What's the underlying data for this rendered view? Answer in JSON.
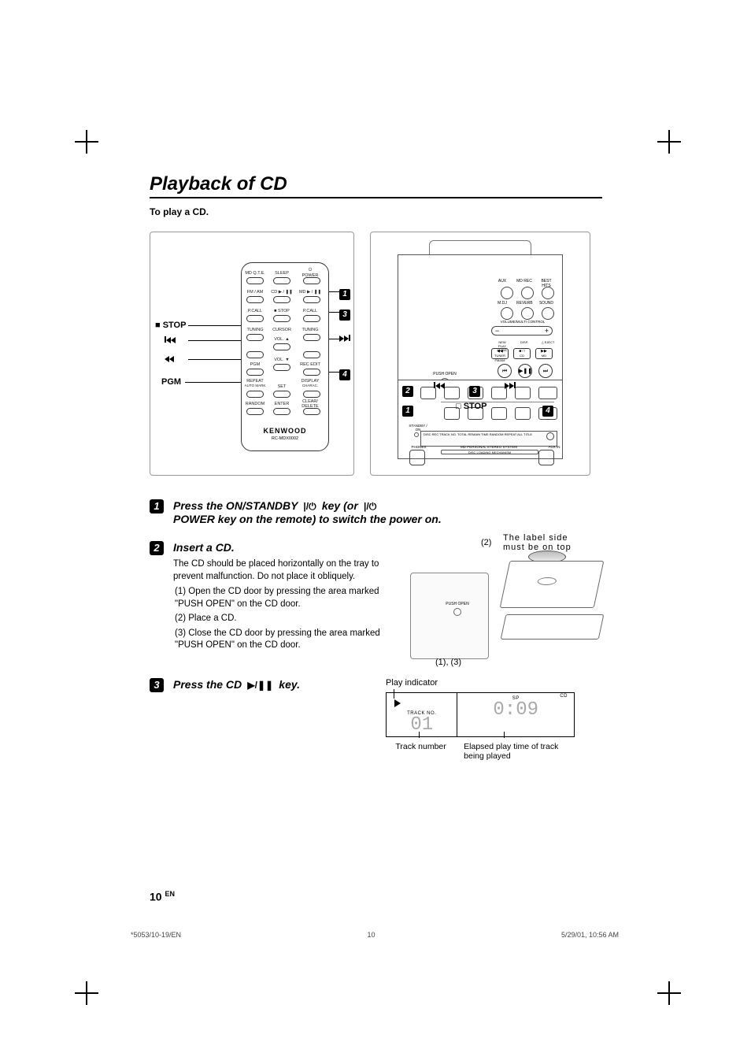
{
  "title": "Playback of CD",
  "lead": "To play a CD.",
  "remote": {
    "side_labels": {
      "stop": "STOP",
      "prev": "prev-track-icon",
      "rew": "rewind-icon",
      "pgm": "PGM"
    },
    "right_badges": [
      "1",
      "3",
      "4"
    ],
    "buttons": {
      "mdqte": "MD Q.T.E.",
      "sleep": "SLEEP",
      "power": "POWER",
      "power_sym": "⏻",
      "fmam": "FM / AM",
      "cd": "CD ▶ / ❚❚",
      "md": "MD ▶ / ❚❚",
      "pcall_l": "P.CALL",
      "stop": "■ STOP",
      "pcall_r": "P.CALL",
      "tuning_l": "TUNING",
      "cursor": "CURSOR",
      "tuning_r": "TUNING",
      "vol_up": "VOL. ▲",
      "pgm": "PGM",
      "vol_dn": "VOL. ▼",
      "recedit": "REC EDIT",
      "repeat": "REPEAT",
      "automark": "AUTO MARK",
      "set": "SET",
      "display": "DISPLAY",
      "charac": "CHARAC.",
      "random": "RANDOM",
      "enter": "ENTER",
      "clear": "CLEAR/\nDELETE"
    },
    "brand": "KENWOOD",
    "model": "RC-MDX0002"
  },
  "unit": {
    "top_knobs_r1": [
      "AUX",
      "MD REC",
      "BEST HITS"
    ],
    "top_knobs_r2": [
      "M.DJ",
      "REVERB",
      "SOUND"
    ],
    "volume_label": "VOLUME/MULTI CONTROL",
    "vol_minus": "−",
    "vol_plus": "+",
    "src_labels": [
      "TUNER FM/AM",
      "CD",
      "MD"
    ],
    "src_top": [
      "NEW  PLAY MODE",
      "DISP.",
      "△ EJECT"
    ],
    "ctrl_icons": [
      "⏮",
      "▶❚❚",
      "⏭"
    ],
    "push_open": "PUSH OPEN",
    "disp_text": "DISC   REC   TRACK NO.   TOTAL REMAIN TIME   RANDOM REPEAT   ALL TITLE",
    "standby": "STANDBY / ON",
    "subtitle": "MD PERSONAL STEREO SYSTEM",
    "mech": "DISC LOADING MECHANISM",
    "side_top_prev": "prev-track-icon",
    "side_top_sym": "▶▶❚",
    "side_stop_l": "stop-icon",
    "side_stop": "STOP",
    "phones": "PHONES",
    "aux": "AUX IN",
    "badges": {
      "1": "1",
      "2": "2",
      "3": "3",
      "4": "4"
    }
  },
  "steps": {
    "s1_head_a": "Press the ON/STANDBY",
    "s1_head_b": "key (or",
    "s1_head_c": "POWER  key on the remote) to switch the power on.",
    "power_sym": "⏻",
    "s2_head": "Insert a CD.",
    "s2_para": "The CD should be placed horizontally on the tray to prevent malfunction. Do not place it obliquely.",
    "s2_1": "(1) Open the CD door by pressing the area marked \"PUSH OPEN\" on the CD door.",
    "s2_2": "(2) Place a CD.",
    "s2_3": "(3) Close the CD door by pressing the area marked \"PUSH OPEN\" on the CD door.",
    "s2_annot_label": "The label side must be on top",
    "s2_annot_2": "(2)",
    "s2_annot_13": "(1), (3)",
    "s2_push_open": "PUSH OPEN",
    "s3_head_a": "Press the CD",
    "s3_head_b": "key.",
    "s3_play_indicator": "Play indicator",
    "s3_track_no_lbl": "TRACK NO.",
    "s3_track_no": "01",
    "s3_sp": "SP",
    "s3_cd": "CD",
    "s3_time": "0:09",
    "s3_cap_left": "Track number",
    "s3_cap_right": "Elapsed play time of track being played"
  },
  "footer": {
    "page_num": "10",
    "page_lang": "EN",
    "doc_ref": "*5053/10-19/EN",
    "mid": "10",
    "datetime": "5/29/01, 10:56 AM"
  }
}
